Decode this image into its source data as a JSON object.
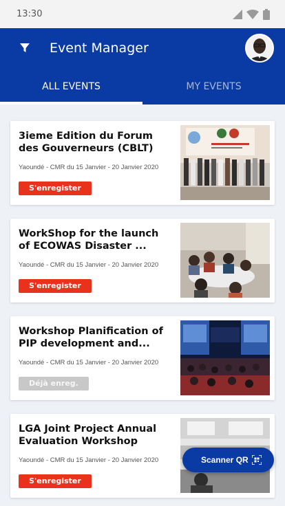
{
  "status": {
    "time": "13:30"
  },
  "header": {
    "title": "Event Manager"
  },
  "tabs": [
    {
      "label": "ALL EVENTS",
      "active": true
    },
    {
      "label": "MY EVENTS",
      "active": false
    }
  ],
  "events": [
    {
      "title": "3ieme Edition du Forum des Gouverneurs (CBLT)",
      "meta": "Yaoundé - CMR du 15 Janvier - 20 Janvier 2020",
      "button": "S'enregister",
      "registered": false
    },
    {
      "title": "WorkShop for the launch of ECOWAS Disaster ...",
      "meta": "Yaoundé - CMR du 15 Janvier - 20 Janvier 2020",
      "button": "S'enregister",
      "registered": false
    },
    {
      "title": "Workshop Planification of PIP development and...",
      "meta": "Yaoundé - CMR du 15 Janvier - 20 Janvier 2020",
      "button": "Déjà enreg.",
      "registered": true
    },
    {
      "title": "LGA Joint Project Annual Evaluation Workshop",
      "meta": "Yaoundé - CMR du 15 Janvier - 20 Janvier 2020",
      "button": "S'enregister",
      "registered": false
    }
  ],
  "fab": {
    "label": "Scanner QR",
    "icon": "qr-scan-icon"
  },
  "colors": {
    "primary": "#0a3aa4",
    "register": "#e9321c",
    "registered": "#c8c8c8",
    "background": "#eef2f7"
  }
}
